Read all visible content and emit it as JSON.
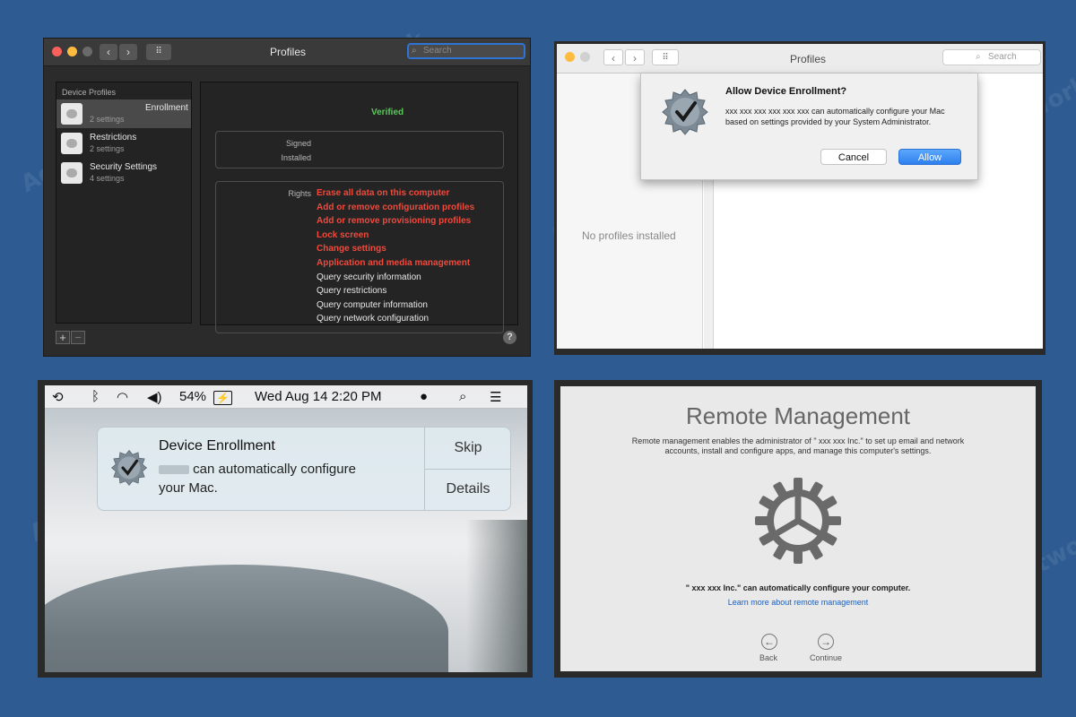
{
  "watermark": "AdvancedNetwork",
  "panel1": {
    "window_title": "Profiles",
    "search_placeholder": "Search",
    "sidebar_header": "Device Profiles",
    "sidebar_items": [
      {
        "name": "Enrollment",
        "sub": "2 settings"
      },
      {
        "name": "Restrictions",
        "sub": "2 settings"
      },
      {
        "name": "Security Settings",
        "sub": "4 settings"
      }
    ],
    "status": "Verified",
    "signed_label": "Signed",
    "installed_label": "Installed",
    "rights_label": "Rights",
    "rights": [
      {
        "text": "Erase all data on this computer",
        "highlight": true
      },
      {
        "text": "Add or remove configuration profiles",
        "highlight": true
      },
      {
        "text": "Add or remove provisioning profiles",
        "highlight": true
      },
      {
        "text": "Lock screen",
        "highlight": true
      },
      {
        "text": "Change settings",
        "highlight": true
      },
      {
        "text": "Application and media management",
        "highlight": true
      },
      {
        "text": "Query security information",
        "highlight": false
      },
      {
        "text": "Query restrictions",
        "highlight": false
      },
      {
        "text": "Query computer information",
        "highlight": false
      },
      {
        "text": "Query network configuration",
        "highlight": false
      }
    ],
    "plus_label": "+",
    "minus_label": "−",
    "help_label": "?"
  },
  "panel2": {
    "window_title": "Profiles",
    "search_placeholder": "Search",
    "empty_text": "No profiles installed",
    "dialog_title": "Allow Device Enrollment?",
    "dialog_body": "xxx xxx xxx xxx xxx xxx    can automatically configure your Mac based on settings provided by your System Administrator.",
    "cancel_label": "Cancel",
    "allow_label": "Allow"
  },
  "panel3": {
    "battery": "54%",
    "clock": "Wed Aug 14  2:20 PM",
    "notif_title": "Device Enrollment",
    "notif_body_tail": " can automatically configure your Mac.",
    "skip_label": "Skip",
    "details_label": "Details"
  },
  "panel4": {
    "title": "Remote Management",
    "description": "Remote management enables the administrator of \" xxx xxx Inc.\" to set up email and network accounts, install and configure apps, and manage this computer's settings.",
    "statement": "\" xxx xxx Inc.\" can automatically configure your computer.",
    "link": "Learn more about remote management",
    "back_label": "Back",
    "continue_label": "Continue"
  },
  "colors": {
    "background": "#2d5b92",
    "rights_highlight": "#ef4a3d",
    "verified": "#5ac95a",
    "allow_button": "#2f7fee"
  }
}
